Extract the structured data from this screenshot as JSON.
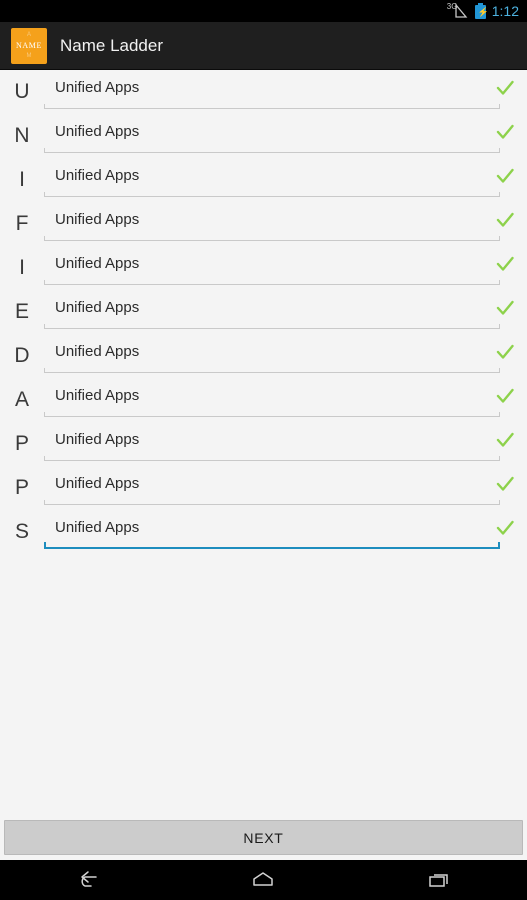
{
  "status_bar": {
    "network_label": "3G",
    "signal_icon": "signal-triangle-icon",
    "battery_icon": "battery-charging-icon",
    "clock": "1:12",
    "clock_color": "#4db2e0",
    "battery_color": "#2196d6"
  },
  "action_bar": {
    "app_icon": {
      "name": "app-logo-icon",
      "top_mark": "A",
      "label": "NAME",
      "bottom_mark": "M",
      "background": "#f5a11b"
    },
    "title": "Name Ladder",
    "background": "#1f1f1f"
  },
  "ladder": {
    "word": "UNIFIEDAPPS",
    "check_color": "#8dd24b",
    "focus_color": "#1d8dbe",
    "rows": [
      {
        "letter": "U",
        "value": "Unified Apps",
        "placeholder": "Unified Apps",
        "valid": true,
        "focused": false
      },
      {
        "letter": "N",
        "value": "Unified Apps",
        "placeholder": "Unified Apps",
        "valid": true,
        "focused": false
      },
      {
        "letter": "I",
        "value": "Unified Apps",
        "placeholder": "Unified Apps",
        "valid": true,
        "focused": false
      },
      {
        "letter": "F",
        "value": "Unified Apps",
        "placeholder": "Unified Apps",
        "valid": true,
        "focused": false
      },
      {
        "letter": "I",
        "value": "Unified Apps",
        "placeholder": "Unified Apps",
        "valid": true,
        "focused": false
      },
      {
        "letter": "E",
        "value": "Unified Apps",
        "placeholder": "Unified Apps",
        "valid": true,
        "focused": false
      },
      {
        "letter": "D",
        "value": "Unified Apps",
        "placeholder": "Unified Apps",
        "valid": true,
        "focused": false
      },
      {
        "letter": "A",
        "value": "Unified Apps",
        "placeholder": "Unified Apps",
        "valid": true,
        "focused": false
      },
      {
        "letter": "P",
        "value": "Unified Apps",
        "placeholder": "Unified Apps",
        "valid": true,
        "focused": false
      },
      {
        "letter": "P",
        "value": "Unified Apps",
        "placeholder": "Unified Apps",
        "valid": true,
        "focused": false
      },
      {
        "letter": "S",
        "value": "Unified Apps",
        "placeholder": "Unified Apps",
        "valid": true,
        "focused": true
      }
    ]
  },
  "footer": {
    "next_label": "NEXT",
    "next_background": "#cccccc"
  },
  "nav_bar": {
    "back": "back-icon",
    "home": "home-icon",
    "recents": "recents-icon"
  }
}
